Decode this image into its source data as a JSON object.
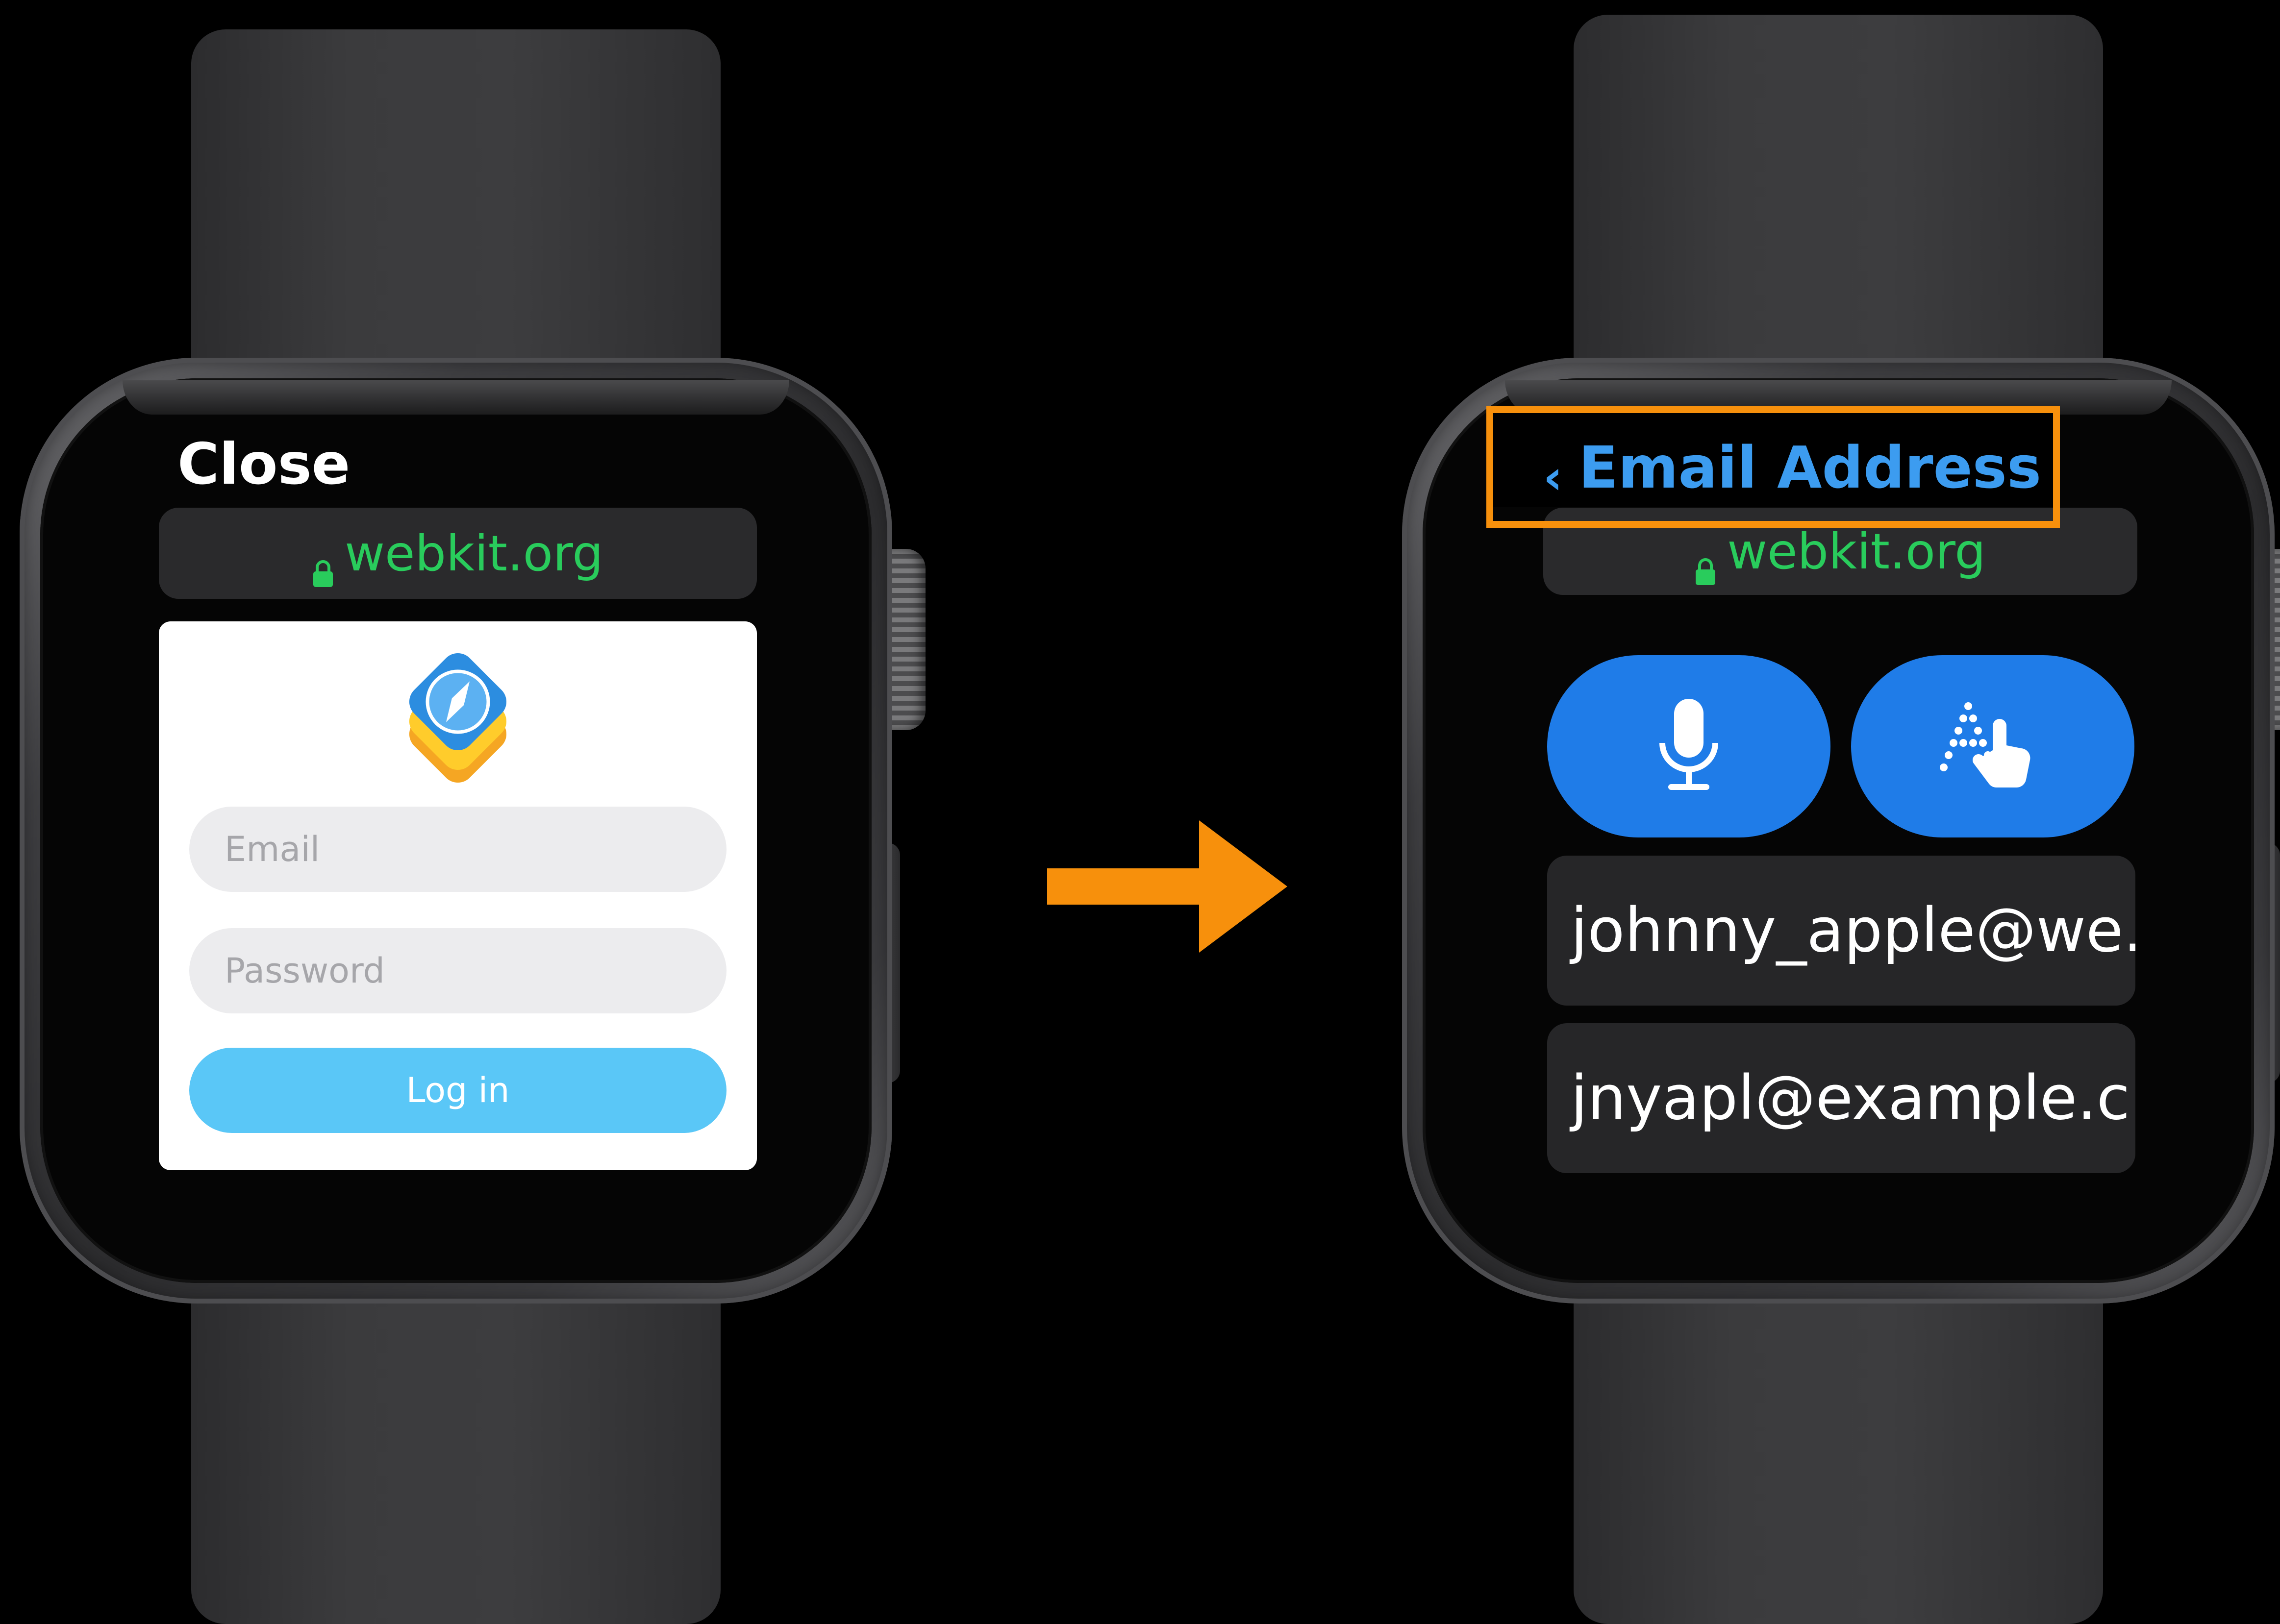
{
  "left_screen": {
    "close_label": "Close",
    "url": "webkit.org",
    "form": {
      "email_placeholder": "Email",
      "password_placeholder": "Password",
      "login_label": "Log in"
    }
  },
  "right_screen": {
    "title": "Email Address",
    "url": "webkit.org",
    "input_options": [
      {
        "icon": "microphone-icon"
      },
      {
        "icon": "scribble-icon"
      }
    ],
    "suggestions": [
      "johnny_apple@we...",
      "jnyapl@example.c..."
    ]
  },
  "colors": {
    "url_green": "#29cc5c",
    "accent_blue": "#1f7ce8",
    "title_blue": "#3c9cf0",
    "highlight_orange": "#f7900c",
    "login_button": "#5ac7f7"
  }
}
